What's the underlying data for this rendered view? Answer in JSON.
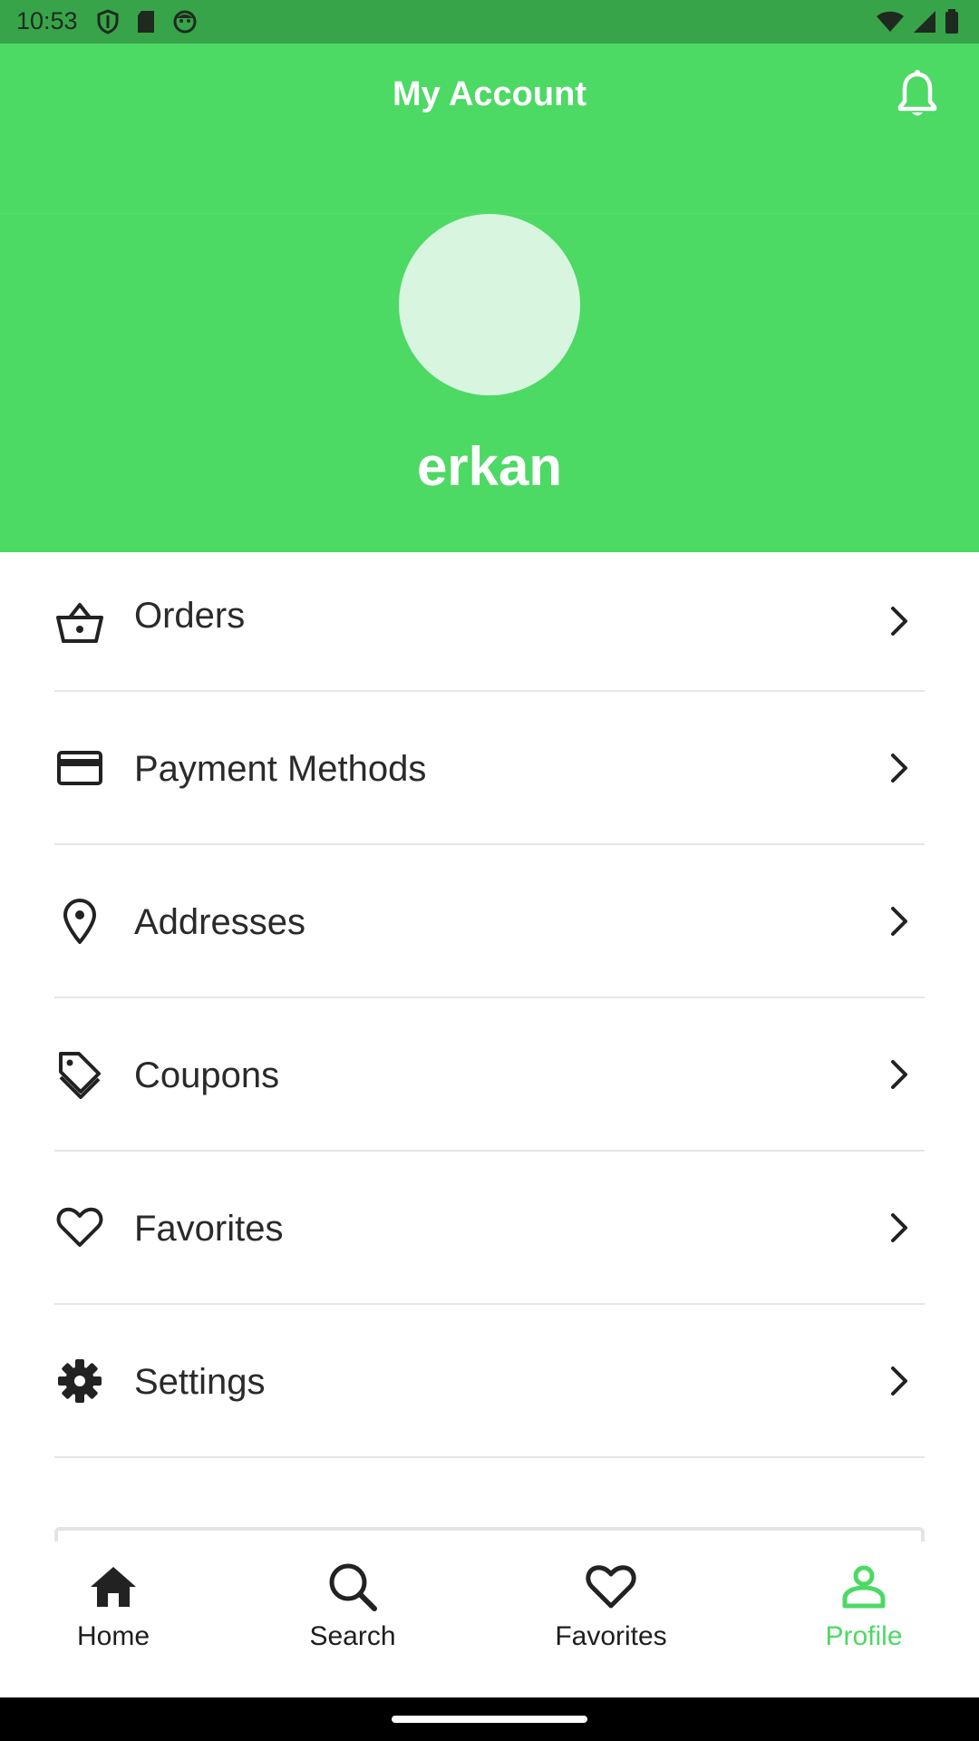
{
  "status_bar": {
    "time": "10:53",
    "left_icons": [
      "shield-icon",
      "sd-card-icon",
      "face-icon"
    ],
    "right_icons": [
      "wifi-icon",
      "cellular-signal-icon",
      "battery-icon"
    ]
  },
  "header": {
    "title": "My Account",
    "bell_icon": "bell-icon",
    "background_color": "#4cd964"
  },
  "profile": {
    "username": "erkan"
  },
  "menu": {
    "items": [
      {
        "label": "Orders",
        "icon": "basket-icon"
      },
      {
        "label": "Payment Methods",
        "icon": "credit-card-icon"
      },
      {
        "label": "Addresses",
        "icon": "location-pin-icon"
      },
      {
        "label": "Coupons",
        "icon": "tag-icon"
      },
      {
        "label": "Favorites",
        "icon": "heart-icon"
      },
      {
        "label": "Settings",
        "icon": "gear-icon"
      }
    ]
  },
  "bottom_nav": {
    "items": [
      {
        "label": "Home",
        "icon": "home-icon",
        "active": false
      },
      {
        "label": "Search",
        "icon": "search-icon",
        "active": false
      },
      {
        "label": "Favorites",
        "icon": "heart-icon",
        "active": false
      },
      {
        "label": "Profile",
        "icon": "person-icon",
        "active": true
      }
    ],
    "active_color": "#4cd964"
  }
}
